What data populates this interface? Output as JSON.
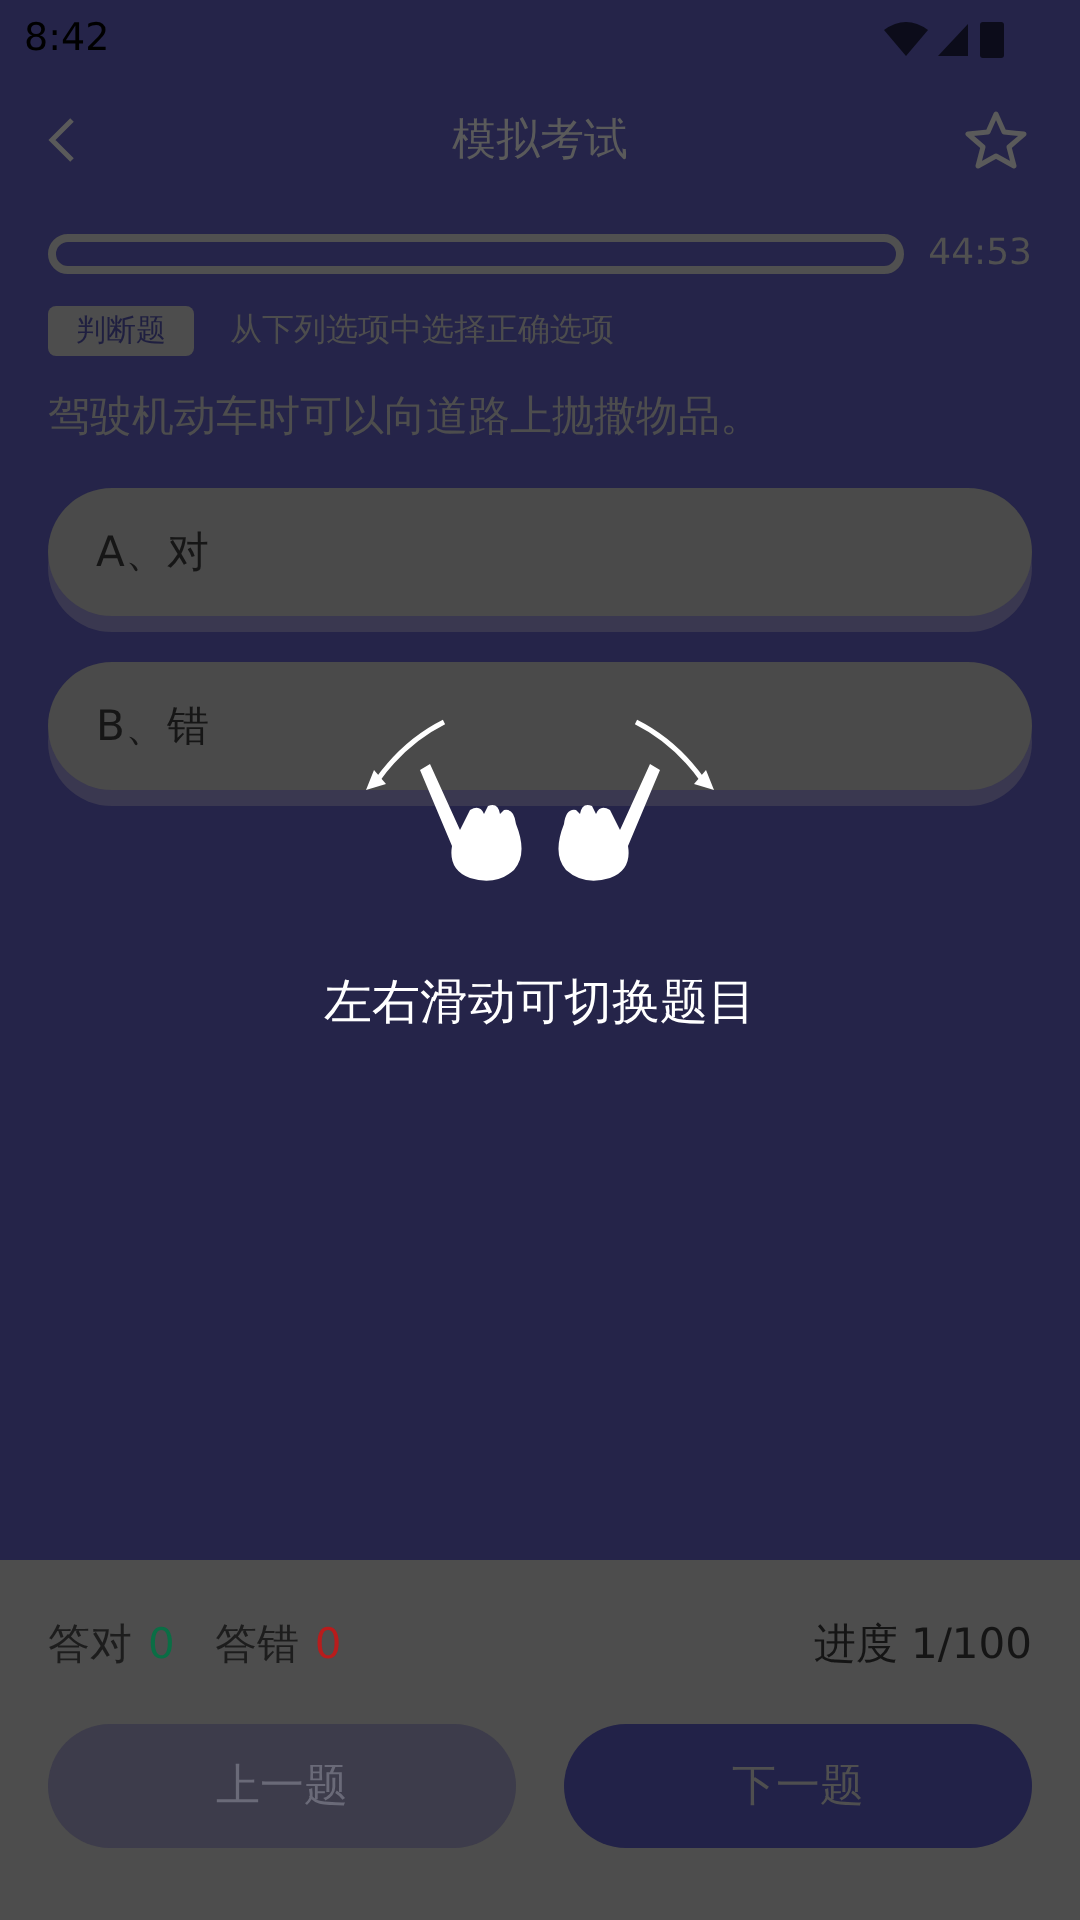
{
  "status_bar": {
    "time": "8:42"
  },
  "header": {
    "title": "模拟考试",
    "favorite": false
  },
  "timer": {
    "level": 0,
    "time": "44:53"
  },
  "question": {
    "type_tag": "判断题",
    "instruction": "从下列选项中选择正确选项",
    "text": "驾驶机动车时可以向道路上抛撒物品。"
  },
  "options": [
    {
      "label": "A、对",
      "selected": false
    },
    {
      "label": "B、错",
      "selected": false
    }
  ],
  "hint": {
    "text": "左右滑动可切换题目"
  },
  "stats": {
    "correct_label": "答对",
    "correct_count": "0",
    "wrong_label": "答错",
    "wrong_count": "0",
    "progress": "进度 1/100"
  },
  "buttons": [
    {
      "label": "上一题",
      "disabled": true
    },
    {
      "label": "下一题",
      "disabled": false
    }
  ]
}
